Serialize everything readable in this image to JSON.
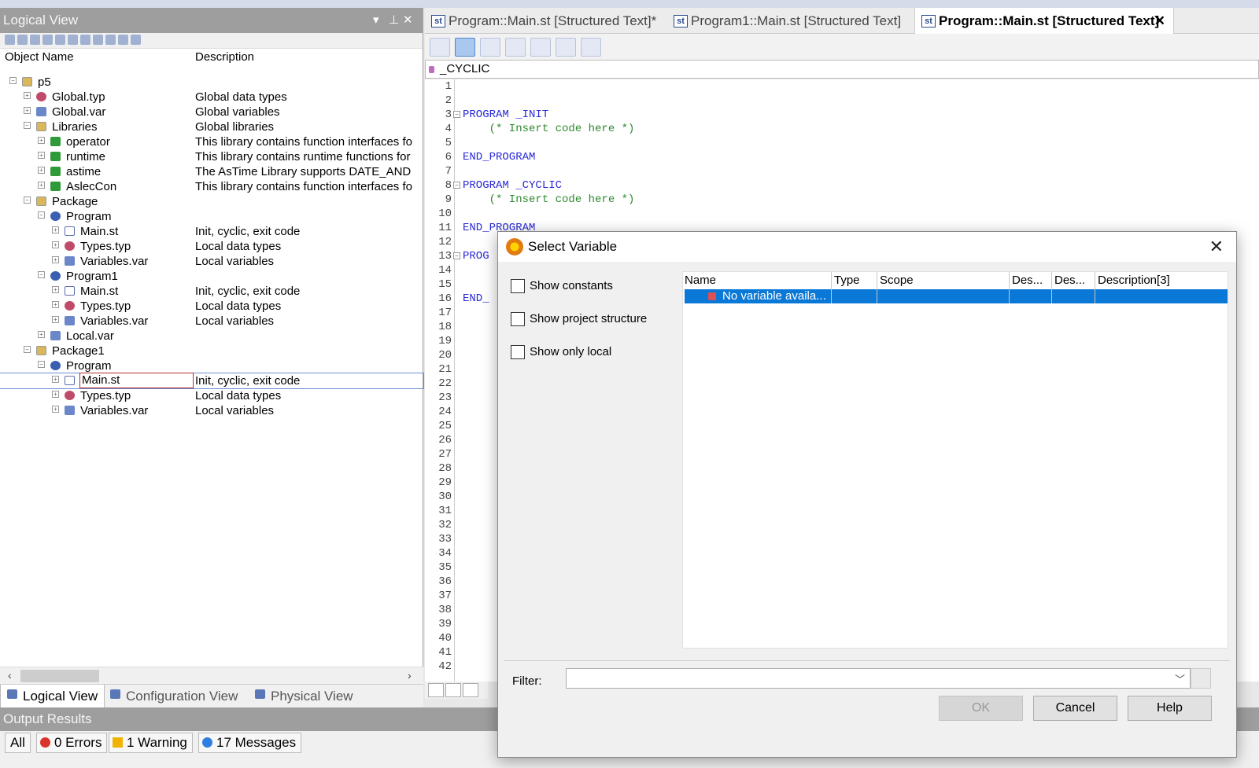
{
  "logical_view": {
    "title": "Logical View",
    "col_object": "Object Name",
    "col_description": "Description",
    "tree": [
      {
        "name": "p5",
        "desc": "",
        "level": 0,
        "icon": "folder-icon",
        "exp": "−"
      },
      {
        "name": "Global.typ",
        "desc": "Global data types",
        "level": 1,
        "icon": "data-type-icon",
        "exp": "+"
      },
      {
        "name": "Global.var",
        "desc": "Global variables",
        "level": 1,
        "icon": "variable-icon",
        "exp": "+"
      },
      {
        "name": "Libraries",
        "desc": "Global libraries",
        "level": 1,
        "icon": "folder-icon",
        "exp": "−"
      },
      {
        "name": "operator",
        "desc": "This library contains function interfaces fo",
        "level": 2,
        "icon": "library-icon",
        "exp": "+"
      },
      {
        "name": "runtime",
        "desc": "This library contains runtime functions for",
        "level": 2,
        "icon": "library-icon",
        "exp": "+"
      },
      {
        "name": "astime",
        "desc": "The AsTime Library supports DATE_AND",
        "level": 2,
        "icon": "library-icon",
        "exp": "+"
      },
      {
        "name": "AslecCon",
        "desc": "This library contains function interfaces fo",
        "level": 2,
        "icon": "library-icon",
        "exp": "+"
      },
      {
        "name": "Package",
        "desc": "",
        "level": 1,
        "icon": "folder-icon",
        "exp": "−"
      },
      {
        "name": "Program",
        "desc": "",
        "level": 2,
        "icon": "program-icon",
        "exp": "−"
      },
      {
        "name": "Main.st",
        "desc": "Init, cyclic, exit code",
        "level": 3,
        "icon": "st-file-icon",
        "exp": "+"
      },
      {
        "name": "Types.typ",
        "desc": "Local data types",
        "level": 3,
        "icon": "data-type-icon",
        "exp": "+"
      },
      {
        "name": "Variables.var",
        "desc": "Local variables",
        "level": 3,
        "icon": "variable-icon",
        "exp": "+"
      },
      {
        "name": "Program1",
        "desc": "",
        "level": 2,
        "icon": "program-icon",
        "exp": "−"
      },
      {
        "name": "Main.st",
        "desc": "Init, cyclic, exit code",
        "level": 3,
        "icon": "st-file-icon",
        "exp": "+"
      },
      {
        "name": "Types.typ",
        "desc": "Local data types",
        "level": 3,
        "icon": "data-type-icon",
        "exp": "+"
      },
      {
        "name": "Variables.var",
        "desc": "Local variables",
        "level": 3,
        "icon": "variable-icon",
        "exp": "+"
      },
      {
        "name": "Local.var",
        "desc": "",
        "level": 2,
        "icon": "variable-icon",
        "exp": "+"
      },
      {
        "name": "Package1",
        "desc": "",
        "level": 1,
        "icon": "folder-icon",
        "exp": "−"
      },
      {
        "name": "Program",
        "desc": "",
        "level": 2,
        "icon": "program-icon",
        "exp": "−"
      },
      {
        "name": "Main.st",
        "desc": "Init, cyclic, exit code",
        "level": 3,
        "icon": "st-file-icon",
        "exp": "+",
        "selected": true
      },
      {
        "name": "Types.typ",
        "desc": "Local data types",
        "level": 3,
        "icon": "data-type-icon",
        "exp": "+"
      },
      {
        "name": "Variables.var",
        "desc": "Local variables",
        "level": 3,
        "icon": "variable-icon",
        "exp": "+"
      }
    ],
    "view_tabs": [
      "Logical View",
      "Configuration View",
      "Physical View"
    ]
  },
  "editor": {
    "tabs": [
      "Program::Main.st [Structured Text]*",
      "Program1::Main.st [Structured Text]",
      "Program::Main.st [Structured Text]"
    ],
    "tab_close": "✕",
    "section": "_CYCLIC",
    "line_count": 42,
    "lines": [
      {
        "n": 2,
        "parts": [
          [
            "kw",
            "PROGRAM _INIT"
          ]
        ],
        "fold": true
      },
      {
        "n": 3,
        "parts": [
          [
            "cm",
            "    (* Insert code here *)"
          ]
        ]
      },
      {
        "n": 5,
        "parts": [
          [
            "kw",
            "END_PROGRAM"
          ]
        ]
      },
      {
        "n": 7,
        "parts": [
          [
            "kw",
            "PROGRAM _CYCLIC"
          ]
        ],
        "fold": true
      },
      {
        "n": 8,
        "parts": [
          [
            "cm",
            "    (* Insert code here *)"
          ]
        ]
      },
      {
        "n": 10,
        "parts": [
          [
            "kw",
            "END_PROGRAM"
          ]
        ]
      },
      {
        "n": 12,
        "parts": [
          [
            "kw",
            "PROG"
          ]
        ],
        "fold": true
      },
      {
        "n": 15,
        "parts": [
          [
            "kw",
            "END_"
          ]
        ]
      }
    ]
  },
  "output": {
    "title": "Output Results",
    "all": "All",
    "errors": "0 Errors",
    "warnings": "1 Warning",
    "messages": "17 Messages"
  },
  "dialog": {
    "title": "Select Variable",
    "close": "✕",
    "checkboxes": [
      "Show constants",
      "Show project structure",
      "Show only local"
    ],
    "columns": [
      "Name",
      "Type",
      "Scope",
      "Des...",
      "Des...",
      "Description[3]"
    ],
    "row": "No variable availa...",
    "filter_label": "Filter:",
    "filter_value": "",
    "ok": "OK",
    "cancel": "Cancel",
    "help": "Help"
  }
}
